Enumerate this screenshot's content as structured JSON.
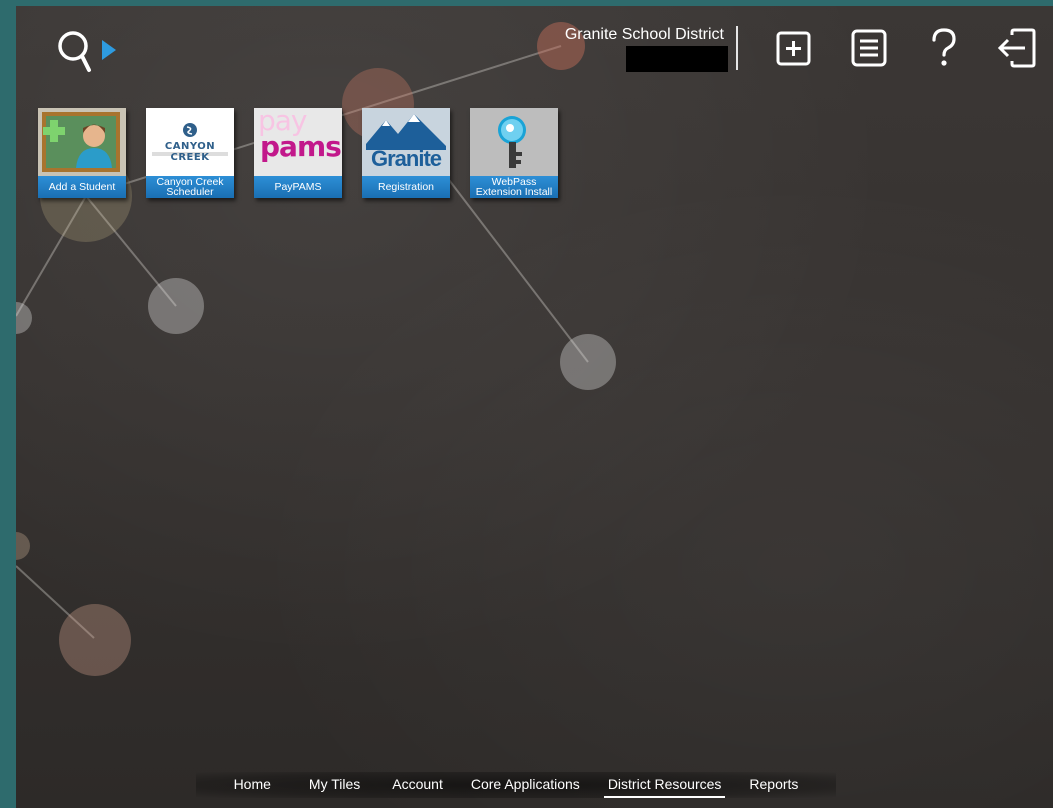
{
  "header": {
    "district_name": "Granite School District",
    "icons": {
      "search": "search-icon",
      "expand": "play-arrow-icon",
      "add": "add-square-icon",
      "menu": "list-menu-icon",
      "help": "help-question-icon",
      "logout": "logout-icon"
    }
  },
  "tiles": [
    {
      "name": "Add a Student",
      "line1": "Add a Student",
      "line2": ""
    },
    {
      "name": "Canyon Creek Scheduler",
      "line1": "Canyon Creek",
      "line2": "Scheduler",
      "logo_text": "CANYON CREEK"
    },
    {
      "name": "PayPAMS",
      "line1": "PayPAMS",
      "line2": "",
      "logo_top": "pay",
      "logo_bottom": "pams"
    },
    {
      "name": "Registration",
      "line1": "Registration",
      "line2": "",
      "logo_text": "Granite"
    },
    {
      "name": "WebPass Extension Install",
      "line1": "WebPass",
      "line2": "Extension Install"
    }
  ],
  "bottom_nav": {
    "items": [
      "Home",
      "My Tiles",
      "Account",
      "Core Applications",
      "District Resources",
      "Reports"
    ],
    "active": "District Resources"
  },
  "colors": {
    "tile_label_blue": "#1a6fb3",
    "background": "#363230",
    "outer_teal": "#2e6b6d",
    "search_arrow": "#2e9be0"
  }
}
